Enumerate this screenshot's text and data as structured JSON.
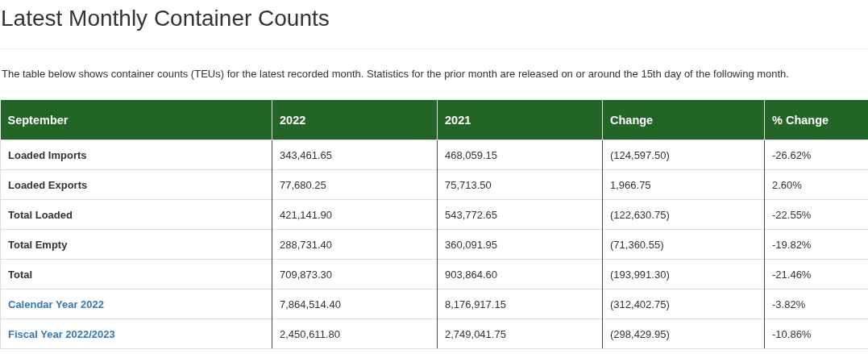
{
  "title": "Latest Monthly Container Counts",
  "intro": "The table below shows container counts (TEUs) for the latest recorded month. Statistics for the prior month are released on or around the 15th day of the following month.",
  "table": {
    "columns": [
      "September",
      "2022",
      "2021",
      "Change",
      "% Change"
    ],
    "rows": [
      {
        "kind": "label",
        "cells": [
          "Loaded Imports",
          "343,461.65",
          "468,059.15",
          "(124,597.50)",
          "-26.62%"
        ]
      },
      {
        "kind": "label",
        "cells": [
          "Loaded Exports",
          "77,680.25",
          "75,713.50",
          "1,966.75",
          "2.60%"
        ]
      },
      {
        "kind": "label",
        "cells": [
          "Total Loaded",
          "421,141.90",
          "543,772.65",
          "(122,630.75)",
          "-22.55%"
        ]
      },
      {
        "kind": "label",
        "cells": [
          "Total Empty",
          "288,731.40",
          "360,091.95",
          "(71,360.55)",
          "-19.82%"
        ]
      },
      {
        "kind": "label",
        "cells": [
          "Total",
          "709,873.30",
          "903,864.60",
          "(193,991.30)",
          "-21.46%"
        ]
      },
      {
        "kind": "link",
        "cells": [
          "Calendar Year 2022",
          "7,864,514.40",
          "8,176,917.15",
          "(312,402.75)",
          "-3.82%"
        ]
      },
      {
        "kind": "link",
        "cells": [
          "Fiscal Year 2022/2023",
          "2,450,611.80",
          "2,749,041.75",
          "(298,429.95)",
          "-10.86%"
        ]
      }
    ]
  }
}
